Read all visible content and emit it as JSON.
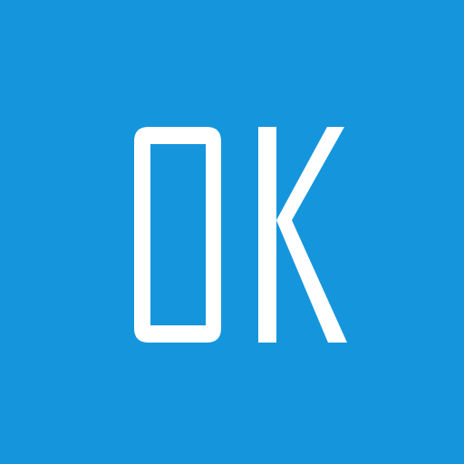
{
  "button": {
    "label": "OK",
    "background_color": "#1596dc",
    "text_color": "#ffffff"
  }
}
